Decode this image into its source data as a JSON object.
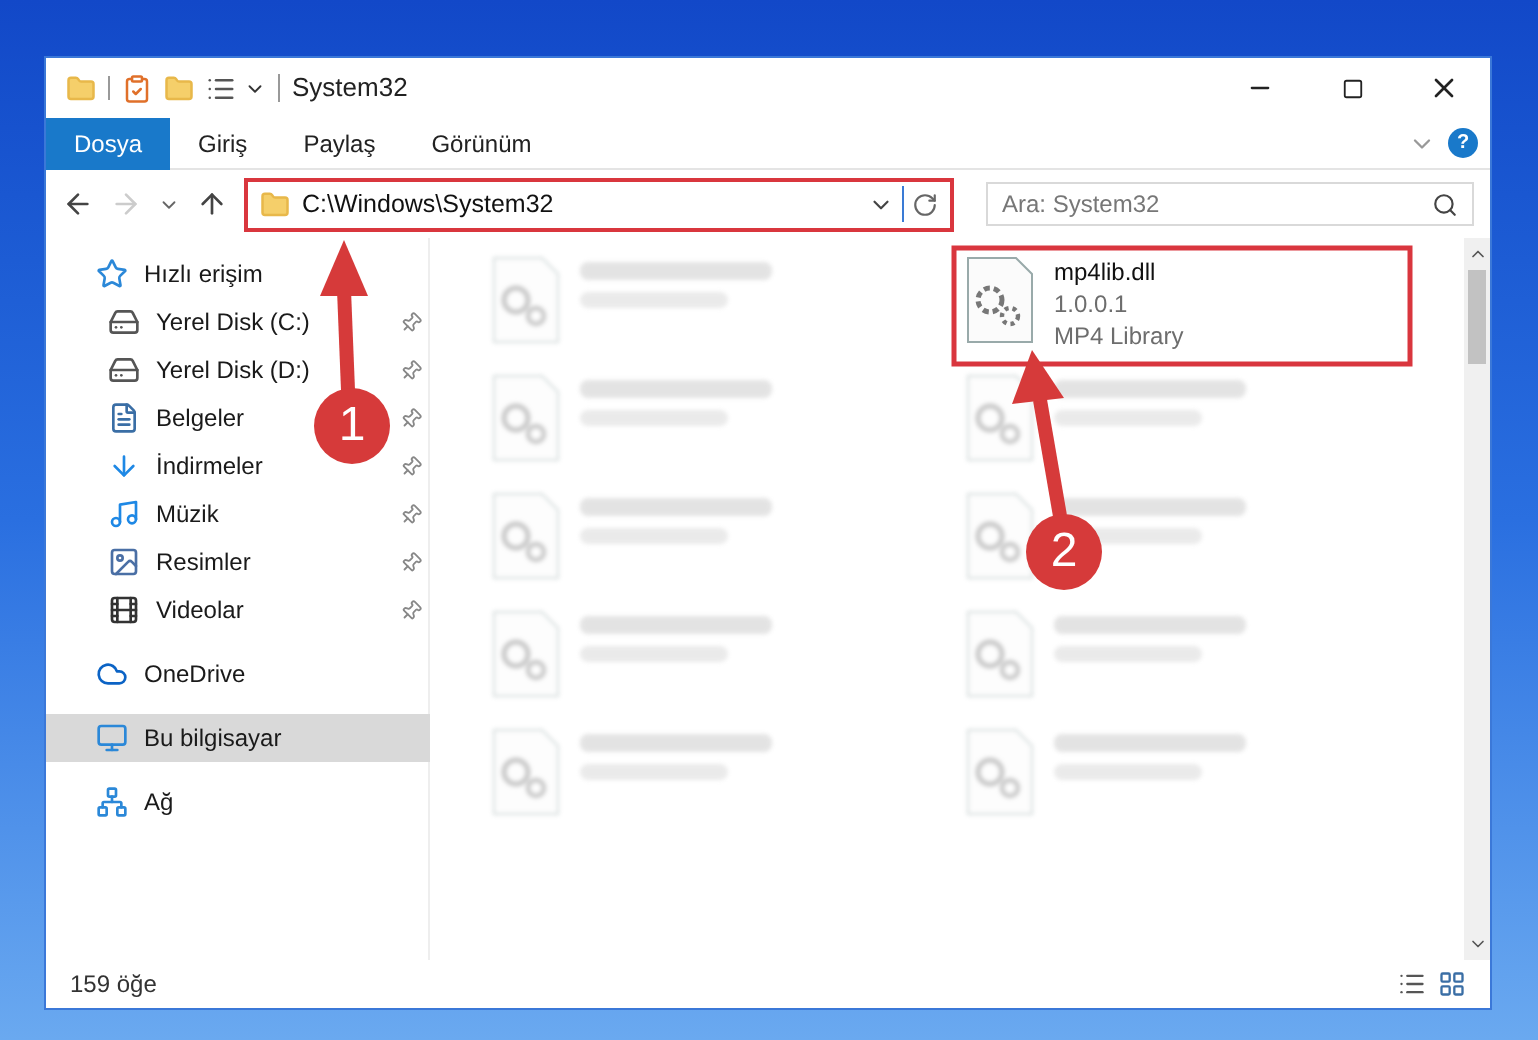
{
  "window": {
    "title": "System32"
  },
  "ribbon": {
    "tabs": [
      {
        "label": "Dosya",
        "selected": true
      },
      {
        "label": "Giriş",
        "selected": false
      },
      {
        "label": "Paylaş",
        "selected": false
      },
      {
        "label": "Görünüm",
        "selected": false
      }
    ]
  },
  "navigation": {
    "back_enabled": true,
    "forward_enabled": false
  },
  "address": {
    "path": "C:\\Windows\\System32",
    "highlighted": true
  },
  "search": {
    "placeholder": "Ara: System32"
  },
  "sidebar": {
    "items": [
      {
        "label": "Hızlı erişim",
        "kind": "star",
        "selected": false,
        "children": [
          {
            "label": "Yerel Disk (C:)",
            "kind": "disk",
            "pinned": true,
            "selected": false
          },
          {
            "label": "Yerel Disk (D:)",
            "kind": "disk",
            "pinned": true,
            "selected": false
          },
          {
            "label": "Belgeler",
            "kind": "documents",
            "pinned": true,
            "selected": false
          },
          {
            "label": "İndirmeler",
            "kind": "downloads",
            "pinned": true,
            "selected": false
          },
          {
            "label": "Müzik",
            "kind": "music",
            "pinned": true,
            "selected": false
          },
          {
            "label": "Resimler",
            "kind": "pictures",
            "pinned": true,
            "selected": false
          },
          {
            "label": "Videolar",
            "kind": "videos",
            "pinned": true,
            "selected": false
          }
        ]
      },
      {
        "label": "OneDrive",
        "kind": "cloud",
        "selected": false
      },
      {
        "label": "Bu bilgisayar",
        "kind": "computer",
        "selected": true
      },
      {
        "label": "Ağ",
        "kind": "network",
        "selected": false
      }
    ]
  },
  "files": [
    {
      "blurred": true
    },
    {
      "name": "mp4lib.dll",
      "version": "1.0.0.1",
      "description": "MP4 Library",
      "blurred": false
    },
    {
      "blurred": true
    },
    {
      "blurred": true
    },
    {
      "blurred": true
    },
    {
      "blurred": true
    },
    {
      "blurred": true
    },
    {
      "blurred": true
    },
    {
      "blurred": true
    },
    {
      "blurred": true
    }
  ],
  "help": {
    "label": "?"
  },
  "status_bar": {
    "count": "159 öğe"
  },
  "annotations": [
    {
      "number": "1"
    },
    {
      "number": "2"
    }
  ]
}
